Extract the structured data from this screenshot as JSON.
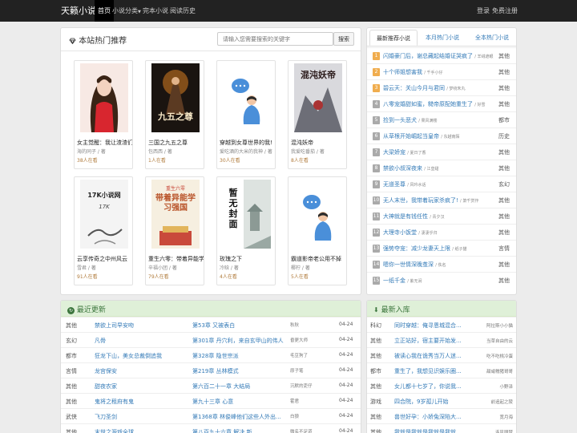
{
  "nav": {
    "brand": "天籁小说",
    "items": [
      "首页",
      "小说分类",
      "完本小说",
      "阅读历史"
    ],
    "login": "登录",
    "register": "免费注册"
  },
  "hot": {
    "title": "本站热门推荐",
    "search_placeholder": "请输入您需要搜索的关键字",
    "search_button": "搜索",
    "books": [
      {
        "title": "女主觉醒：我让渣渣们",
        "author": "海的同子 / 著",
        "reads": "38人在看"
      },
      {
        "title": "三国之九五之尊",
        "author": "包西西 / 著",
        "reads": "1人在看"
      },
      {
        "title": "穿越到女尊世界的我!",
        "author": "爱吃酒的大米的我神 / 著",
        "reads": "30人在看"
      },
      {
        "title": "混沌妖帝",
        "author": "我爱吃番茄 / 著",
        "reads": "8人在看"
      },
      {
        "title": "云享传奇之中州风云",
        "author": "雪君 / 著",
        "reads": "91人在看"
      },
      {
        "title": "重生六零：带着异能学",
        "author": "辛福小团 / 著",
        "reads": "79人在看"
      },
      {
        "title": "玫瑰之下",
        "author": "冷晗 / 著",
        "reads": "4人在看"
      },
      {
        "title": "霸道影帝老公用不掉",
        "author": "椰柠 / 著",
        "reads": "5人在看"
      }
    ],
    "cover_text": {
      "b2": "九五之尊",
      "b4": "混沌妖帝",
      "b5_title": "17K小说网",
      "b5_sub": "17K",
      "b6_title": "带着异能学习强国",
      "b6_tag": "重生六零",
      "b7": "暂无封面"
    }
  },
  "rank": {
    "tabs": [
      "最新推荐小说",
      "本月热门小说",
      "全本热门小说"
    ],
    "items": [
      {
        "num": "1",
        "title": "闪婚豪门后，谢总藏起结婚证哭疯了",
        "author": "羊绒遮眼",
        "cat": "其他"
      },
      {
        "num": "2",
        "title": "十个师姐想害我",
        "author": "千手小仔",
        "cat": "其他"
      },
      {
        "num": "3",
        "title": "碧云天：关山今月与君同",
        "author": "梦绕朱丸",
        "cat": "其他"
      },
      {
        "num": "4",
        "title": "八零宠婚甜如蜜，糙帝原配她重生了",
        "author": "好雪",
        "cat": "其他"
      },
      {
        "num": "5",
        "title": "捡到一头恶犬",
        "author": "果风满楼",
        "cat": "都市"
      },
      {
        "num": "6",
        "title": "从草根开始崛起当皇帝",
        "author": "东越南陌",
        "cat": "历史"
      },
      {
        "num": "7",
        "title": "大梁娇宠",
        "author": "夏日了香",
        "cat": "其他"
      },
      {
        "num": "8",
        "title": "禁欲小叔深夜来",
        "author": "江皇甜",
        "cat": "其他"
      },
      {
        "num": "9",
        "title": "无道圣尊",
        "author": "风吟水话",
        "cat": "玄幻"
      },
      {
        "num": "10",
        "title": "无人末世，我带着玩家杀疯了!",
        "author": "箫千赏作",
        "cat": "其他"
      },
      {
        "num": "11",
        "title": "大神就是有钱任性",
        "author": "青夕汉",
        "cat": "其他"
      },
      {
        "num": "12",
        "title": "大理寺小饭堂",
        "author": "凄凄乎归",
        "cat": "其他"
      },
      {
        "num": "13",
        "title": "强势夺宠：减少龙妻天上限",
        "author": "纸子猫",
        "cat": "言情"
      },
      {
        "num": "14",
        "title": "嗯你一世情深晚茧深",
        "author": "佚名",
        "cat": "其他"
      },
      {
        "num": "15",
        "title": "一纸千金",
        "author": "紫无涧",
        "cat": "其他"
      }
    ]
  },
  "updates": {
    "title": "最近更新",
    "rows": [
      {
        "cat": "其他",
        "name": "禁欲上司早安吻",
        "chapter": "第53章 又被表白",
        "author": "秋秋",
        "date": "04-24"
      },
      {
        "cat": "玄幻",
        "name": "凡骨",
        "chapter": "第301章 丹穴利，来自玄甲山的伟人",
        "author": "昏更大师",
        "date": "04-24"
      },
      {
        "cat": "都市",
        "name": "狂龙下山，美女总裁倒追我",
        "chapter": "第328章 隐世宗派",
        "author": "毛豆狗了",
        "date": "04-24"
      },
      {
        "cat": "言情",
        "name": "龙宫保安",
        "chapter": "第219章 丛林模式",
        "author": "原子笔",
        "date": "04-24"
      },
      {
        "cat": "其他",
        "name": "甜夜农家",
        "chapter": "第六百二十一章 大结局",
        "author": "沉默的吏仔",
        "date": "04-24"
      },
      {
        "cat": "其他",
        "name": "鬼将之租府有鬼",
        "chapter": "第九十三章 心意",
        "author": "霍君",
        "date": "04-24"
      },
      {
        "cat": "武侠",
        "name": "飞刀圣剑",
        "chapter": "第1368章 林俊峰他们这些人外出...",
        "author": "白狼",
        "date": "04-24"
      },
      {
        "cat": "其他",
        "name": "末世之源戏全球",
        "chapter": "第八百九十六章 解决 新",
        "author": "微名不足道",
        "date": "04-24"
      }
    ]
  },
  "latest": {
    "title": "最新入库",
    "rows": [
      {
        "cat": "科幻",
        "name": "同时穿越：俺寻恩城混合...",
        "author": "阿拉斯小小猫"
      },
      {
        "cat": "其他",
        "name": "立正站好，宿主要开始发...",
        "author": "当草自由的云"
      },
      {
        "cat": "其他",
        "name": "被读心我在诡秀当万人迷...",
        "author": "吃不吃桃冷蛋"
      },
      {
        "cat": "都市",
        "name": "重生了，我想见识娱乐圈...",
        "author": "甜咸糯猪哥哥"
      },
      {
        "cat": "其他",
        "name": "女儿都十七岁了，你说我...",
        "author": "小野泽"
      },
      {
        "cat": "游戏",
        "name": "四合院，9岁孤儿开始",
        "author": "前追起之陵"
      },
      {
        "cat": "其他",
        "name": "兽世好孕：小娇兔深陷大...",
        "author": "宽月海"
      },
      {
        "cat": "其他",
        "name": "我就是我就是我就是我就...",
        "author": "连风顾梦"
      }
    ]
  },
  "colors": {
    "nav_bg": "#222222",
    "link": "#337ab7",
    "rank_top": "#f0ad4e",
    "list_head": "#dff0d8",
    "list_head_text": "#3c763d"
  },
  "icons": {
    "hot": "diamond-icon",
    "updates": "refresh-icon",
    "latest": "download-icon"
  }
}
